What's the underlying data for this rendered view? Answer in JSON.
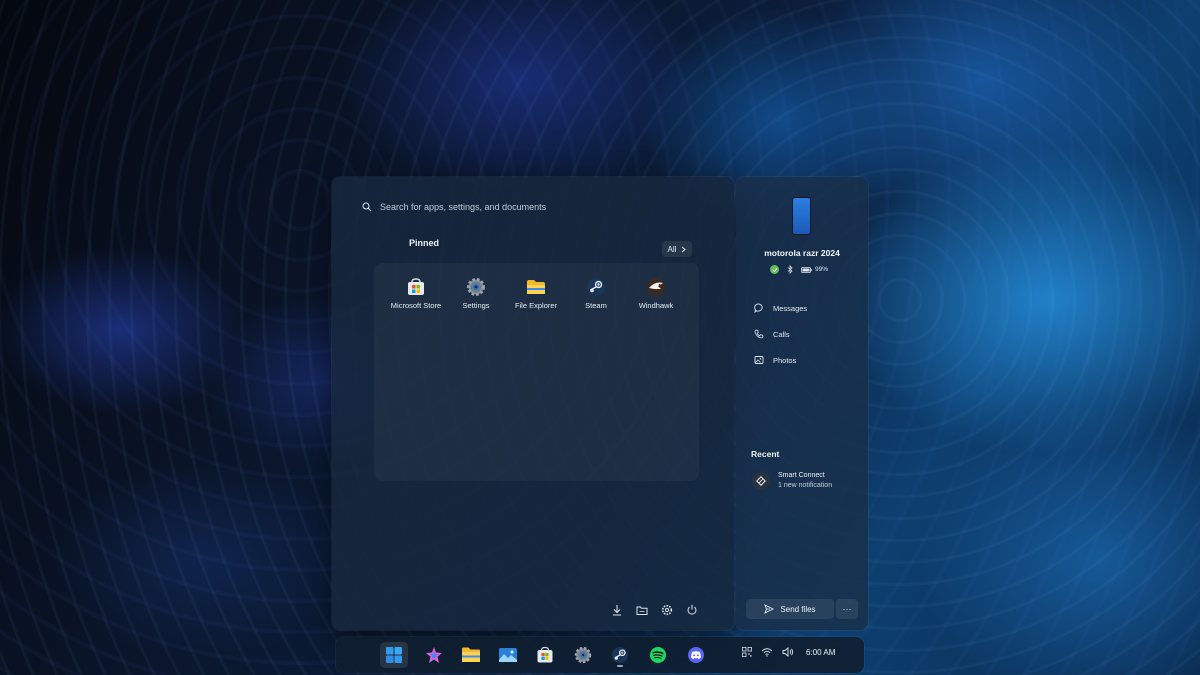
{
  "search": {
    "placeholder": "Search for apps, settings, and documents"
  },
  "pinned": {
    "title": "Pinned",
    "all_label": "All",
    "apps": [
      {
        "label": "Microsoft Store",
        "icon": "microsoft-store-icon"
      },
      {
        "label": "Settings",
        "icon": "settings-gear-icon"
      },
      {
        "label": "File Explorer",
        "icon": "folder-icon"
      },
      {
        "label": "Steam",
        "icon": "steam-icon"
      },
      {
        "label": "Windhawk",
        "icon": "windhawk-icon"
      }
    ]
  },
  "footer": {
    "buttons": [
      "downloads-icon",
      "documents-folder-icon",
      "settings-icon",
      "power-icon"
    ]
  },
  "phone": {
    "name": "motorola razr 2024",
    "battery": "99%",
    "quick_links": [
      {
        "label": "Messages",
        "icon": "messages-icon"
      },
      {
        "label": "Calls",
        "icon": "calls-icon"
      },
      {
        "label": "Photos",
        "icon": "photos-icon"
      }
    ],
    "recent_title": "Recent",
    "notification": {
      "app": "Smart Connect",
      "text": "1 new notification"
    },
    "send_label": "Send files",
    "more_label": "···"
  },
  "taskbar": {
    "apps": [
      "start-icon",
      "bing-copilot-icon",
      "file-explorer-icon",
      "photos-icon",
      "microsoft-store-icon",
      "settings-icon",
      "steam-icon",
      "spotify-icon",
      "discord-icon"
    ],
    "time": "6:00 AM"
  },
  "colors": {
    "accent": "#3a8ee6",
    "battery_ok": "#5fc05a",
    "spotify": "#1ed760",
    "discord": "#5865f2"
  }
}
